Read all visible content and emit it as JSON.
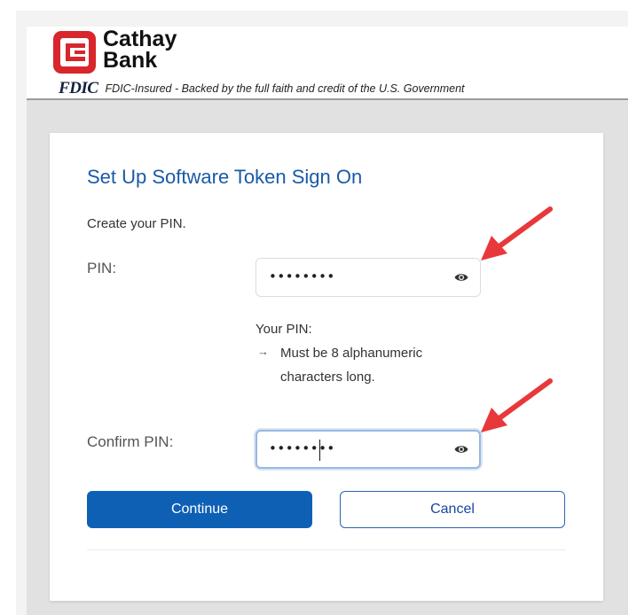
{
  "brand": {
    "name_line1": "Cathay",
    "name_line2": "Bank",
    "fdic_logo": "FDIC",
    "fdic_text": "FDIC-Insured - Backed by the full faith and credit of the U.S. Government",
    "logo_color": "#d8262c"
  },
  "form": {
    "title": "Set Up Software Token Sign On",
    "intro": "Create your PIN.",
    "pin": {
      "label": "PIN:",
      "masked_value": "••••••••",
      "toggle_icon": "eye-icon"
    },
    "rules": {
      "heading": "Your PIN:",
      "arrow": "→",
      "items": [
        "Must be 8 alphanumeric characters long."
      ]
    },
    "confirm_pin": {
      "label": "Confirm PIN:",
      "masked_value": "••••••••",
      "toggle_icon": "eye-icon",
      "focused": true
    },
    "buttons": {
      "continue": "Continue",
      "cancel": "Cancel"
    }
  },
  "annotations": {
    "arrow_color": "#e8383c",
    "arrow_icon": "red-pointer-arrow-icon"
  },
  "colors": {
    "accent": "#0e60b5",
    "title": "#1a5aa8"
  }
}
